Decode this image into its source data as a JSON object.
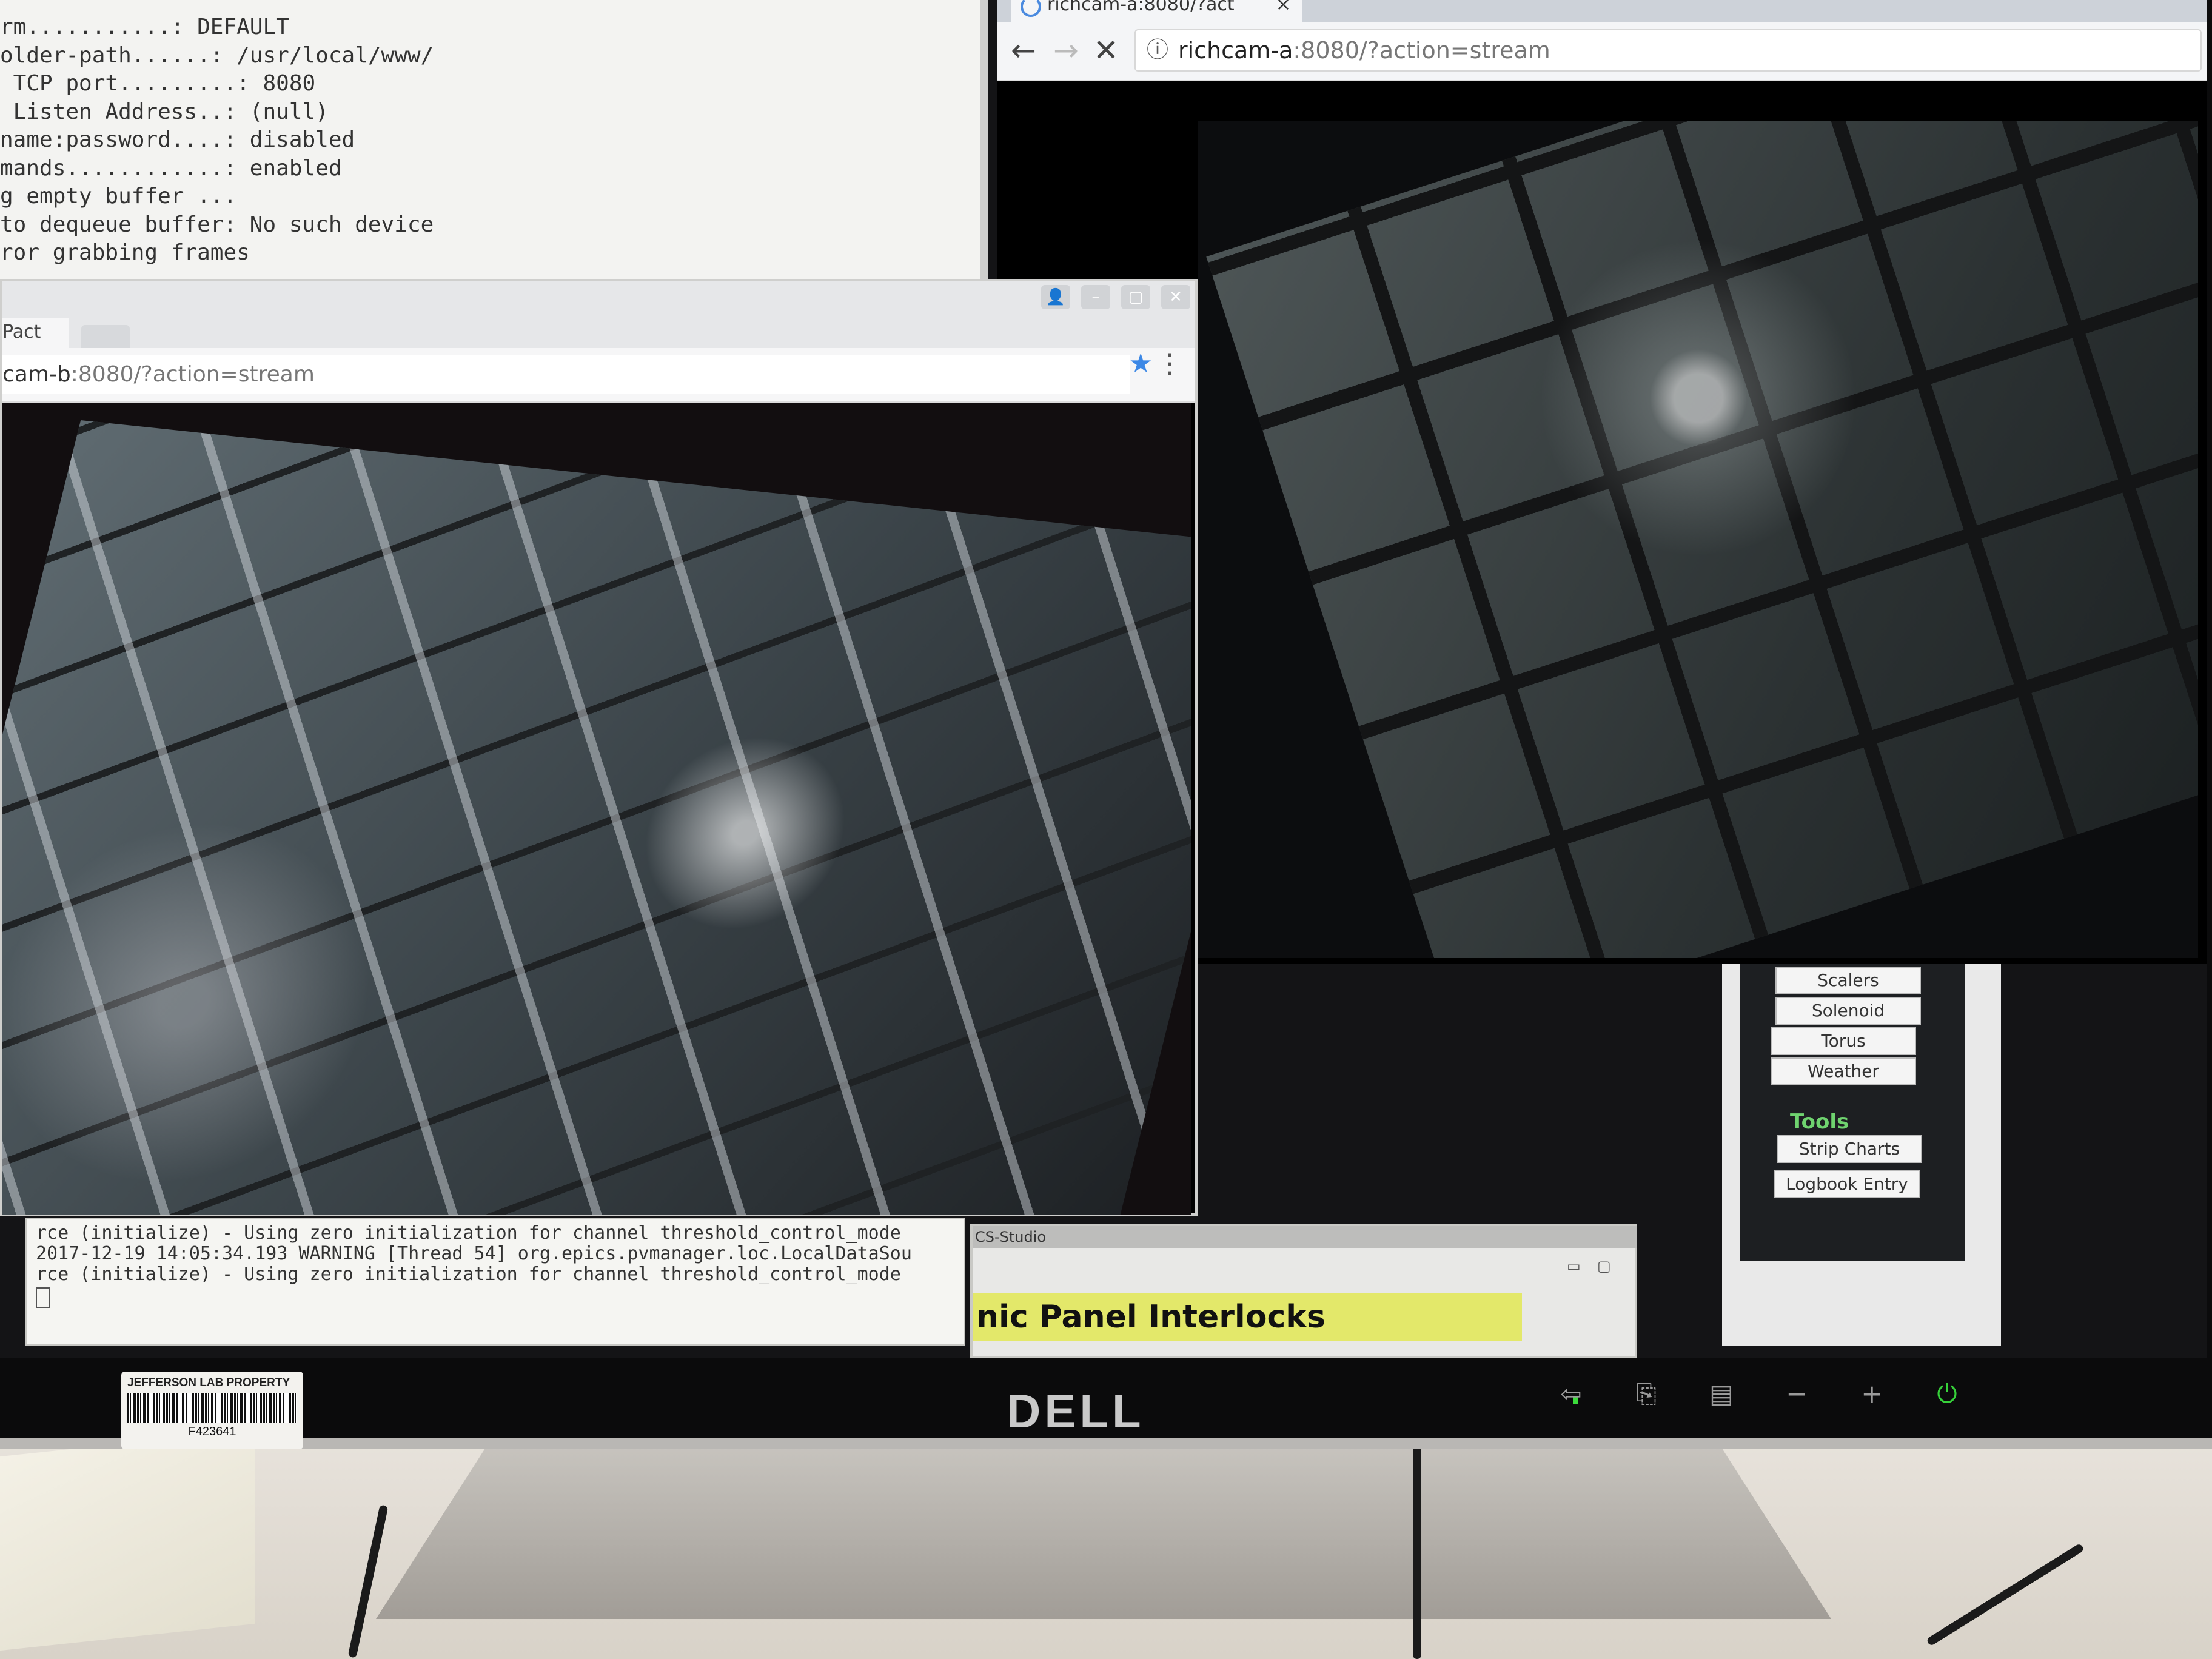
{
  "terminal": {
    "lines": [
      "rm...........: DEFAULT",
      "older-path......: /usr/local/www/",
      " TCP port.........: 8080",
      " Listen Address..: (null)",
      "name:password....: disabled",
      "mands............: enabled",
      "g empty buffer ...",
      "to dequeue buffer: No such device",
      "ror grabbing frames"
    ]
  },
  "browser_a": {
    "tab_label": "richcam-a:8080/?act",
    "tab_close": "×",
    "back": "←",
    "forward": "→",
    "stop": "✕",
    "info_icon": "ⓘ",
    "url_host": "richcam-a",
    "url_rest": ":8080/?action=stream"
  },
  "browser_b": {
    "tab_label": "Pact",
    "tab_close": "×",
    "url_host": "cam-b",
    "url_rest": ":8080/?action=stream",
    "star": "★",
    "menu": "⋮",
    "win_profile": "👤",
    "win_min": "–",
    "win_max": "▢",
    "win_close": "✕"
  },
  "console": {
    "lines": [
      "rce (initialize) - Using zero initialization for channel threshold_control_mode",
      "2017-12-19 14:05:34.193 WARNING [Thread 54] org.epics.pvmanager.loc.LocalDataSou",
      "rce (initialize) - Using zero initialization for channel threshold_control_mode"
    ]
  },
  "cs_studio": {
    "title": "CS-Studio",
    "min": "▭",
    "max": "▢",
    "header": "nic Panel Interlocks"
  },
  "tools_panel": {
    "items": [
      "Scalers",
      "Solenoid",
      "Torus",
      "Weather"
    ],
    "tools_label": "Tools",
    "tools": [
      "Strip Charts",
      "Logbook Entry"
    ]
  },
  "monitor": {
    "brand": "DELL",
    "asset_label": "JEFFERSON LAB PROPERTY",
    "asset_number": "F423641",
    "buttons": [
      "⇦",
      "⎘",
      "▤",
      "−",
      "+",
      "⏻"
    ]
  },
  "colors": {
    "cs_header_bg": "#e3e86a",
    "tools_label": "#6fd36f",
    "bookmark_star": "#3c88e6"
  }
}
